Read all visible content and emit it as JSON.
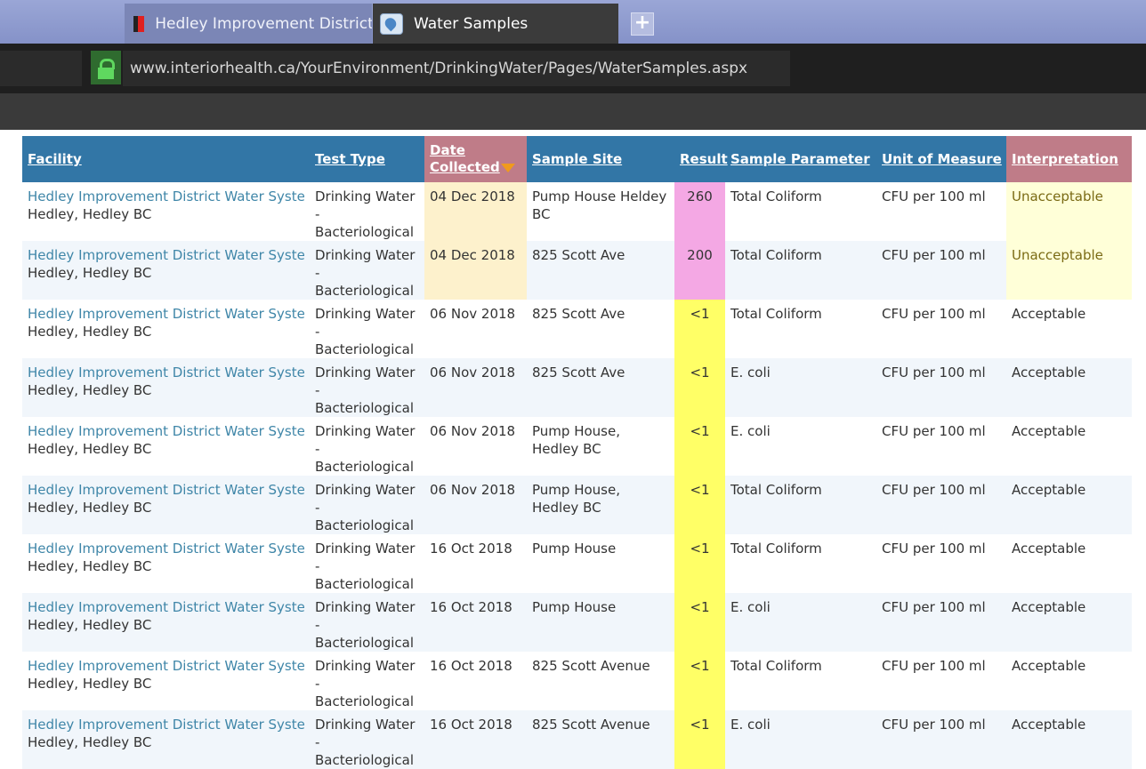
{
  "browser": {
    "tabs": [
      {
        "title": "Hedley Improvement District Water System",
        "active": false
      },
      {
        "title": "Water Samples",
        "active": true
      }
    ],
    "new_tab_label": "+",
    "url": "www.interiorhealth.ca/YourEnvironment/DrinkingWater/Pages/WaterSamples.aspx"
  },
  "table": {
    "headers": {
      "facility": "Facility",
      "test_type": "Test Type",
      "date_collected": "Date Collected",
      "sample_site": "Sample Site",
      "result": "Result",
      "sample_parameter": "Sample Parameter",
      "unit_of_measure": "Unit of Measure",
      "interpretation": "Interpretation"
    },
    "sorted_column": "date_collected",
    "sort_direction": "descending",
    "colors": {
      "header_bg": "#3276a6",
      "highlight_header_bg": "#bf7c88",
      "result_unacceptable_bg": "#f4a8e4",
      "result_acceptable_bg": "#ffff66",
      "facility_link": "#3f86a8"
    },
    "rows": [
      {
        "facility": "Hedley Improvement District Water System",
        "location": "Hedley, Hedley BC",
        "test_type": "Drinking Water - Bacteriological",
        "date": "04 Dec 2018",
        "site": "Pump House Heldey BC",
        "result": "260",
        "parameter": "Total Coliform",
        "unit": "CFU per 100 ml",
        "interpretation": "Unacceptable"
      },
      {
        "facility": "Hedley Improvement District Water System",
        "location": "Hedley, Hedley BC",
        "test_type": "Drinking Water - Bacteriological",
        "date": "04 Dec 2018",
        "site": "825 Scott Ave",
        "result": "200",
        "parameter": "Total Coliform",
        "unit": "CFU per 100 ml",
        "interpretation": "Unacceptable"
      },
      {
        "facility": "Hedley Improvement District Water System",
        "location": "Hedley, Hedley BC",
        "test_type": "Drinking Water - Bacteriological",
        "date": "06 Nov 2018",
        "site": "825 Scott Ave",
        "result": "<1",
        "parameter": "Total Coliform",
        "unit": "CFU per 100 ml",
        "interpretation": "Acceptable"
      },
      {
        "facility": "Hedley Improvement District Water System",
        "location": "Hedley, Hedley BC",
        "test_type": "Drinking Water - Bacteriological",
        "date": "06 Nov 2018",
        "site": "825 Scott Ave",
        "result": "<1",
        "parameter": "E. coli",
        "unit": "CFU per 100 ml",
        "interpretation": "Acceptable"
      },
      {
        "facility": "Hedley Improvement District Water System",
        "location": "Hedley, Hedley BC",
        "test_type": "Drinking Water - Bacteriological",
        "date": "06 Nov 2018",
        "site": "Pump House, Hedley BC",
        "result": "<1",
        "parameter": "E. coli",
        "unit": "CFU per 100 ml",
        "interpretation": "Acceptable"
      },
      {
        "facility": "Hedley Improvement District Water System",
        "location": "Hedley, Hedley BC",
        "test_type": "Drinking Water - Bacteriological",
        "date": "06 Nov 2018",
        "site": "Pump House, Hedley BC",
        "result": "<1",
        "parameter": "Total Coliform",
        "unit": "CFU per 100 ml",
        "interpretation": "Acceptable"
      },
      {
        "facility": "Hedley Improvement District Water System",
        "location": "Hedley, Hedley BC",
        "test_type": "Drinking Water - Bacteriological",
        "date": "16 Oct 2018",
        "site": "Pump House",
        "result": "<1",
        "parameter": "Total Coliform",
        "unit": "CFU per 100 ml",
        "interpretation": "Acceptable"
      },
      {
        "facility": "Hedley Improvement District Water System",
        "location": "Hedley, Hedley BC",
        "test_type": "Drinking Water - Bacteriological",
        "date": "16 Oct 2018",
        "site": "Pump House",
        "result": "<1",
        "parameter": "E. coli",
        "unit": "CFU per 100 ml",
        "interpretation": "Acceptable"
      },
      {
        "facility": "Hedley Improvement District Water System",
        "location": "Hedley, Hedley BC",
        "test_type": "Drinking Water - Bacteriological",
        "date": "16 Oct 2018",
        "site": "825 Scott Avenue",
        "result": "<1",
        "parameter": "Total Coliform",
        "unit": "CFU per 100 ml",
        "interpretation": "Acceptable"
      },
      {
        "facility": "Hedley Improvement District Water System",
        "location": "Hedley, Hedley BC",
        "test_type": "Drinking Water - Bacteriological",
        "date": "16 Oct 2018",
        "site": "825 Scott Avenue",
        "result": "<1",
        "parameter": "E. coli",
        "unit": "CFU per 100 ml",
        "interpretation": "Acceptable"
      }
    ]
  }
}
